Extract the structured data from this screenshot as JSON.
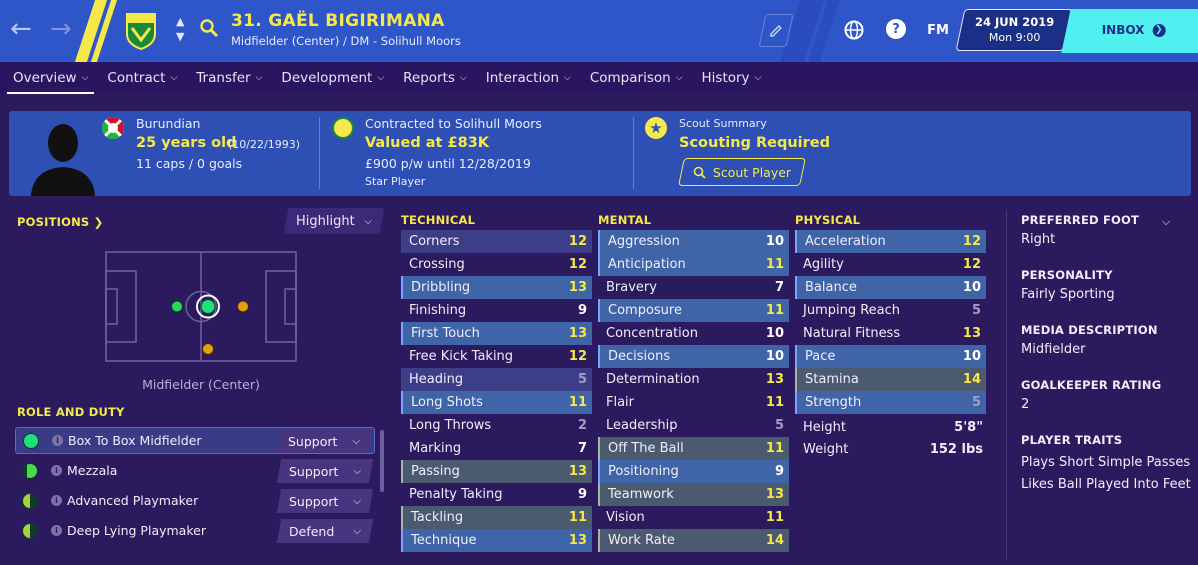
{
  "header": {
    "player_name": "31. GAËL BIGIRIMANA",
    "player_subtitle": "Midfielder (Center) / DM - Solihull Moors",
    "fm_label": "FM",
    "date": "24 JUN 2019",
    "time": "Mon 9:00",
    "inbox_label": "INBOX",
    "icons": [
      "back-arrow-icon",
      "forward-arrow-icon",
      "club-badge",
      "up-down-icon",
      "search-icon",
      "edit-icon",
      "globe-icon",
      "help-icon"
    ]
  },
  "tabs": [
    {
      "label": "Overview",
      "active": true
    },
    {
      "label": "Contract"
    },
    {
      "label": "Transfer"
    },
    {
      "label": "Development"
    },
    {
      "label": "Reports"
    },
    {
      "label": "Interaction"
    },
    {
      "label": "Comparison"
    },
    {
      "label": "History"
    }
  ],
  "card": {
    "nationality": "Burundian",
    "age": "25 years old",
    "dob": "(10/22/1993)",
    "caps": "11 caps / 0 goals",
    "contract_line": "Contracted to Solihull Moors",
    "value": "Valued at £83K",
    "wage": "£900 p/w until 12/28/2019",
    "status": "Star Player",
    "scout_title": "Scout Summary",
    "scout_status": "Scouting Required",
    "scout_button": "Scout Player"
  },
  "positions": {
    "title": "POSITIONS",
    "highlight_label": "Highlight",
    "caption": "Midfielder (Center)"
  },
  "roles": {
    "title": "ROLE AND DUTY",
    "items": [
      {
        "name": "Box To Box Midfielder",
        "duty": "Support",
        "color": "#1fe07a",
        "selected": true
      },
      {
        "name": "Mezzala",
        "duty": "Support",
        "color": "#4fd64a"
      },
      {
        "name": "Advanced Playmaker",
        "duty": "Support",
        "color": "#a8d23a"
      },
      {
        "name": "Deep Lying Playmaker",
        "duty": "Defend",
        "color": "#a8d23a"
      }
    ]
  },
  "technical": {
    "title": "TECHNICAL",
    "rows": [
      {
        "name": "Corners",
        "value": "12",
        "style": "s"
      },
      {
        "name": "Crossing",
        "value": "12",
        "style": ""
      },
      {
        "name": "Dribbling",
        "value": "13",
        "style": "h"
      },
      {
        "name": "Finishing",
        "value": "9",
        "style": ""
      },
      {
        "name": "First Touch",
        "value": "13",
        "style": "h"
      },
      {
        "name": "Free Kick Taking",
        "value": "12",
        "style": ""
      },
      {
        "name": "Heading",
        "value": "5",
        "style": "s"
      },
      {
        "name": "Long Shots",
        "value": "11",
        "style": "h"
      },
      {
        "name": "Long Throws",
        "value": "2",
        "style": ""
      },
      {
        "name": "Marking",
        "value": "7",
        "style": ""
      },
      {
        "name": "Passing",
        "value": "13",
        "style": "g"
      },
      {
        "name": "Penalty Taking",
        "value": "9",
        "style": ""
      },
      {
        "name": "Tackling",
        "value": "11",
        "style": "g"
      },
      {
        "name": "Technique",
        "value": "13",
        "style": "h"
      }
    ]
  },
  "mental": {
    "title": "MENTAL",
    "rows": [
      {
        "name": "Aggression",
        "value": "10",
        "style": "h"
      },
      {
        "name": "Anticipation",
        "value": "11",
        "style": "h"
      },
      {
        "name": "Bravery",
        "value": "7",
        "style": ""
      },
      {
        "name": "Composure",
        "value": "11",
        "style": "h"
      },
      {
        "name": "Concentration",
        "value": "10",
        "style": ""
      },
      {
        "name": "Decisions",
        "value": "10",
        "style": "h"
      },
      {
        "name": "Determination",
        "value": "13",
        "style": ""
      },
      {
        "name": "Flair",
        "value": "11",
        "style": ""
      },
      {
        "name": "Leadership",
        "value": "5",
        "style": ""
      },
      {
        "name": "Off The Ball",
        "value": "11",
        "style": "g"
      },
      {
        "name": "Positioning",
        "value": "9",
        "style": "h"
      },
      {
        "name": "Teamwork",
        "value": "13",
        "style": "g"
      },
      {
        "name": "Vision",
        "value": "11",
        "style": ""
      },
      {
        "name": "Work Rate",
        "value": "14",
        "style": "g"
      }
    ]
  },
  "physical": {
    "title": "PHYSICAL",
    "rows": [
      {
        "name": "Acceleration",
        "value": "12",
        "style": "h"
      },
      {
        "name": "Agility",
        "value": "12",
        "style": ""
      },
      {
        "name": "Balance",
        "value": "10",
        "style": "h"
      },
      {
        "name": "Jumping Reach",
        "value": "5",
        "style": ""
      },
      {
        "name": "Natural Fitness",
        "value": "13",
        "style": ""
      },
      {
        "name": "Pace",
        "value": "10",
        "style": "h"
      },
      {
        "name": "Stamina",
        "value": "14",
        "style": "g"
      },
      {
        "name": "Strength",
        "value": "5",
        "style": "h"
      }
    ],
    "height_label": "Height",
    "height": "5'8\"",
    "weight_label": "Weight",
    "weight": "152 lbs"
  },
  "right_panel": {
    "foot_title": "PREFERRED FOOT",
    "foot": "Right",
    "personality_title": "PERSONALITY",
    "personality": "Fairly Sporting",
    "media_title": "MEDIA DESCRIPTION",
    "media": "Midfielder",
    "gk_title": "GOALKEEPER RATING",
    "gk": "2",
    "traits_title": "PLAYER TRAITS",
    "traits": [
      "Plays Short Simple Passes",
      "Likes Ball Played Into Feet"
    ]
  },
  "colors": {
    "accent": "#f5e84a",
    "header": "#2e56c8",
    "background": "#2c1a5e",
    "inbox": "#4ff0ef"
  }
}
